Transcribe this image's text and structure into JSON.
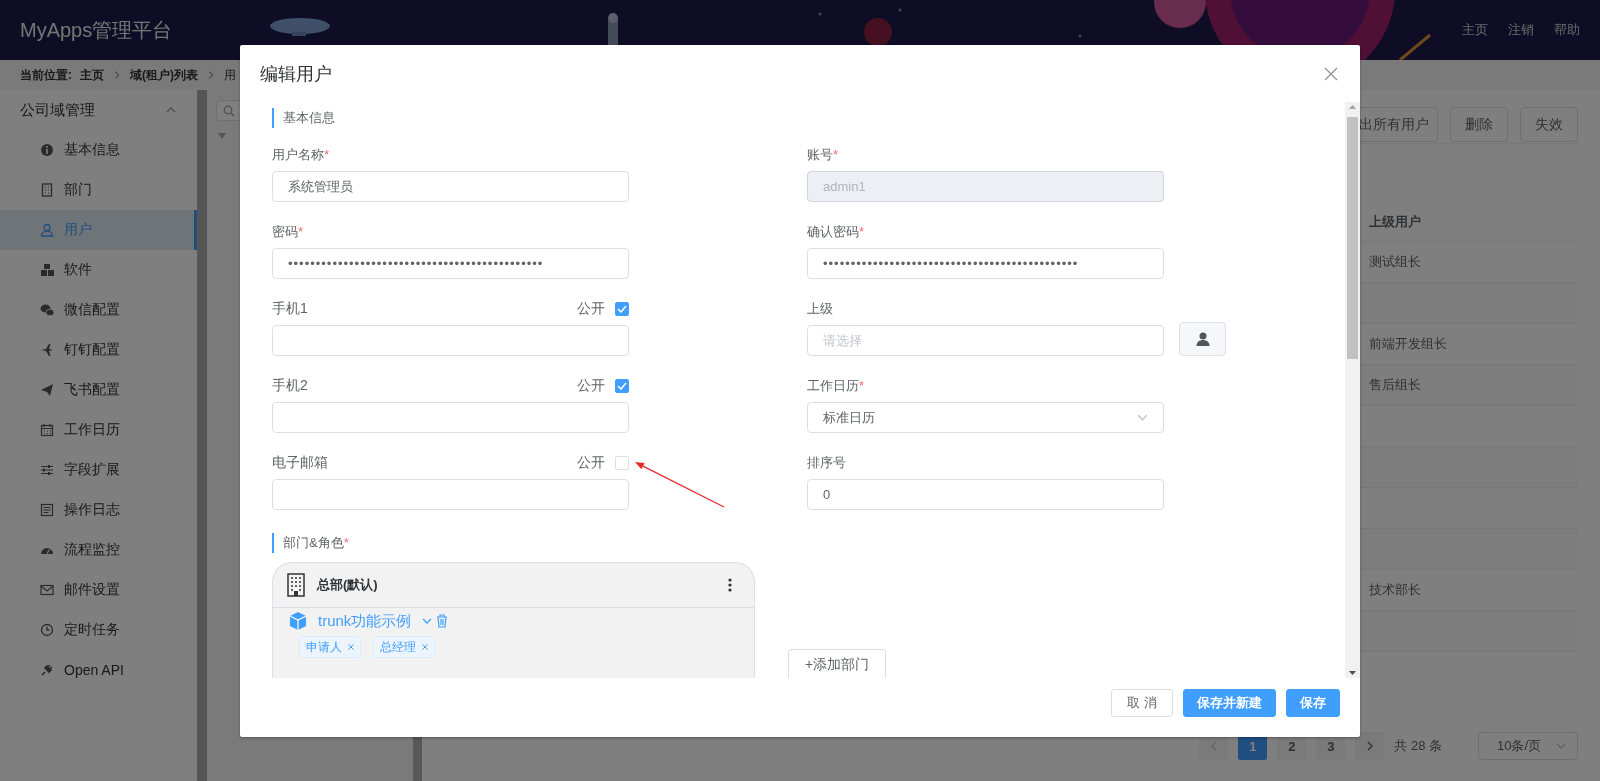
{
  "header": {
    "title": "MyApps管理平台",
    "links": [
      "主页",
      "注销",
      "帮助"
    ]
  },
  "breadcrumb": {
    "label": "当前位置:",
    "items": [
      "主页",
      "域(租户)列表",
      "用"
    ]
  },
  "sidebar": {
    "group": {
      "label": "公司域管理",
      "expanded": true
    },
    "items": [
      {
        "label": "基本信息",
        "selected": false
      },
      {
        "label": "部门",
        "selected": false
      },
      {
        "label": "用户",
        "selected": true
      },
      {
        "label": "软件",
        "selected": false
      },
      {
        "label": "微信配置",
        "selected": false
      },
      {
        "label": "钉钉配置",
        "selected": false
      },
      {
        "label": "飞书配置",
        "selected": false
      },
      {
        "label": "工作日历",
        "selected": false
      },
      {
        "label": "字段扩展",
        "selected": false
      },
      {
        "label": "操作日志",
        "selected": false
      },
      {
        "label": "流程监控",
        "selected": false
      },
      {
        "label": "邮件设置",
        "selected": false
      },
      {
        "label": "定时任务",
        "selected": false
      },
      {
        "label": "Open API",
        "selected": false
      }
    ]
  },
  "toolbar": {
    "buttons": [
      "出所有用户",
      "删除",
      "失效"
    ]
  },
  "table": {
    "columns": [
      "上级用户"
    ],
    "rows": [
      {
        "cells": [
          "测试组长"
        ]
      },
      {
        "cells": []
      },
      {
        "cells": [
          "前端开发组长"
        ]
      },
      {
        "cells": [
          "售后组长"
        ]
      },
      {
        "cells": []
      },
      {
        "cells": []
      },
      {
        "cells": []
      },
      {
        "cells": []
      },
      {
        "cells": [
          "技术部长"
        ]
      },
      {
        "cells": []
      }
    ]
  },
  "pagination": {
    "pages": [
      {
        "label": "1",
        "selected": true
      },
      {
        "label": "2",
        "selected": false
      },
      {
        "label": "3",
        "selected": false
      }
    ],
    "total": "共 28 条",
    "page_size": "10条/页"
  },
  "dialog": {
    "title": "编辑用户",
    "basic_section": "基本信息",
    "fields": [
      {
        "label": "用户名称",
        "required_mark": "*",
        "kind": "text",
        "value": "系统管理员",
        "disabled": false
      },
      {
        "label": "账号",
        "required_mark": "*",
        "kind": "text",
        "value": "admin1",
        "disabled": true
      },
      {
        "label": "密码",
        "required_mark": "*",
        "kind": "password",
        "value": "••••••••••••••••••••••••••••••••••••••••••••••",
        "disabled": false
      },
      {
        "label": "确认密码",
        "required_mark": "*",
        "kind": "password",
        "value": "••••••••••••••••••••••••••••••••••••••••••••••",
        "disabled": false
      },
      {
        "label": "手机1",
        "kind": "public_text",
        "public": {
          "label": "公开",
          "checked": true
        },
        "disabled": false
      },
      {
        "label": "上级",
        "kind": "picker",
        "placeholder": "请选择",
        "disabled": false
      },
      {
        "label": "手机2",
        "kind": "public_text",
        "public": {
          "label": "公开",
          "checked": true
        },
        "disabled": false
      },
      {
        "label": "工作日历",
        "required_mark": "*",
        "kind": "select",
        "value": "标准日历",
        "disabled": false
      },
      {
        "label": "电子邮箱",
        "kind": "public_text",
        "public": {
          "label": "公开",
          "checked": false
        },
        "disabled": false
      },
      {
        "label": "排序号",
        "kind": "text",
        "value": "0",
        "disabled": false
      }
    ],
    "department_section": {
      "title": "部门&角色",
      "required_mark": "*",
      "departments": [
        {
          "name": "总部(默认)",
          "units": [
            {
              "name": "trunk功能示例",
              "roles": [
                "申请人",
                "总经理"
              ]
            }
          ]
        }
      ],
      "add_button": "+添加部门"
    },
    "buttons": [
      {
        "label": "取 消",
        "kind": "default"
      },
      {
        "label": "保存并新建",
        "kind": "primary"
      },
      {
        "label": "保存",
        "kind": "primary"
      }
    ]
  }
}
